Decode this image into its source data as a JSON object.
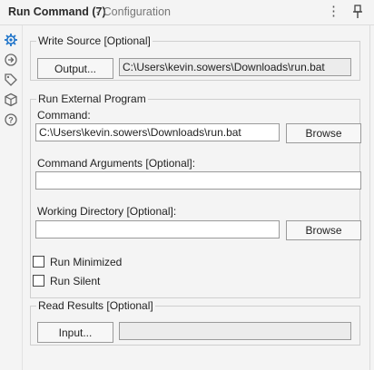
{
  "header": {
    "title": "Run Command (7)",
    "subtitle": "- Configuration",
    "menu_icon": "more-vertical-icon",
    "pin_icon": "pin-icon"
  },
  "sidebar": {
    "items": [
      {
        "icon": "gear-icon",
        "active": true
      },
      {
        "icon": "arrow-circle-icon",
        "active": false
      },
      {
        "icon": "tag-icon",
        "active": false
      },
      {
        "icon": "cube-icon",
        "active": false
      },
      {
        "icon": "help-icon",
        "active": false
      }
    ]
  },
  "write_source": {
    "legend": "Write Source [Optional]",
    "button_label": "Output...",
    "path_value": "C:\\Users\\kevin.sowers\\Downloads\\run.bat"
  },
  "run_program": {
    "legend": "Run External Program",
    "command_label": "Command:",
    "command_value": "C:\\Users\\kevin.sowers\\Downloads\\run.bat",
    "browse_label": "Browse",
    "args_label": "Command Arguments [Optional]:",
    "args_value": "",
    "workdir_label": "Working Directory [Optional]:",
    "workdir_value": "",
    "workdir_browse_label": "Browse"
  },
  "options": {
    "run_minimized_label": "Run Minimized",
    "run_minimized_checked": false,
    "run_silent_label": "Run Silent",
    "run_silent_checked": false
  },
  "read_results": {
    "legend": "Read Results [Optional]",
    "button_label": "Input...",
    "path_value": ""
  }
}
